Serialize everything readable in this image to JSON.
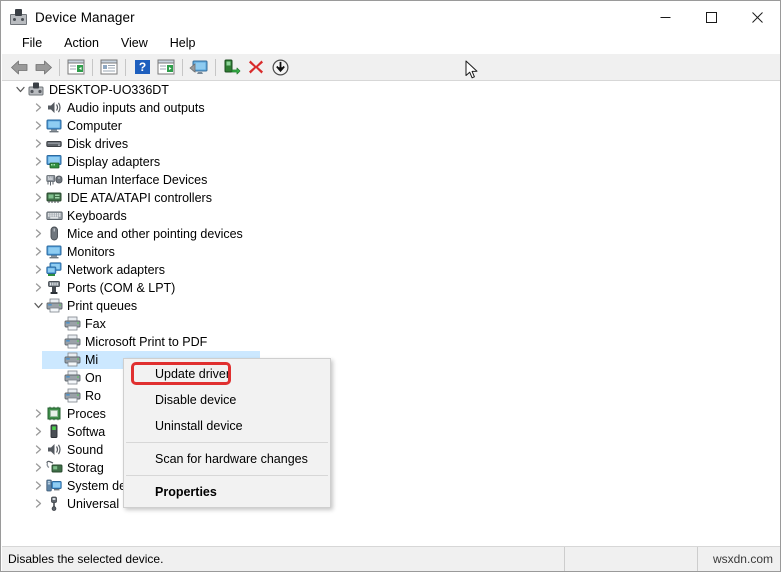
{
  "window": {
    "title": "Device Manager",
    "icon": "device-manager-icon",
    "minimize_label": "Minimize",
    "maximize_label": "Maximize",
    "close_label": "Close"
  },
  "menubar": {
    "items": [
      {
        "label": "File",
        "name": "menu-file"
      },
      {
        "label": "Action",
        "name": "menu-action"
      },
      {
        "label": "View",
        "name": "menu-view"
      },
      {
        "label": "Help",
        "name": "menu-help"
      }
    ]
  },
  "toolbar": {
    "buttons": [
      {
        "name": "back-button",
        "icon": "arrow-left-icon",
        "tooltip": "Back"
      },
      {
        "name": "forward-button",
        "icon": "arrow-right-icon",
        "tooltip": "Forward"
      },
      {
        "name": "show-hide-console-tree-button",
        "icon": "console-tree-icon",
        "tooltip": "Show/Hide Console Tree"
      },
      {
        "name": "properties-button",
        "icon": "properties-icon",
        "tooltip": "Properties"
      },
      {
        "name": "help-button",
        "icon": "help-icon",
        "tooltip": "Help"
      },
      {
        "name": "action-menu-button",
        "icon": "action-menu-icon",
        "tooltip": "Action"
      },
      {
        "name": "scan-hardware-changes-button",
        "icon": "scan-monitor-icon",
        "tooltip": "Scan for hardware changes"
      },
      {
        "name": "update-driver-button",
        "icon": "update-driver-icon",
        "tooltip": "Update Driver Software"
      },
      {
        "name": "uninstall-device-button",
        "icon": "red-x-icon",
        "tooltip": "Uninstall device"
      },
      {
        "name": "disable-device-button",
        "icon": "disable-arrow-icon",
        "tooltip": "Disable device"
      }
    ]
  },
  "tree": {
    "root": {
      "label": "DESKTOP-UO336DT",
      "icon": "computer-root-icon",
      "expanded": true,
      "indent": 0
    },
    "items": [
      {
        "label": "Audio inputs and outputs",
        "icon": "speaker-icon",
        "expanded": false,
        "indent": 1
      },
      {
        "label": "Computer",
        "icon": "monitor-icon",
        "expanded": false,
        "indent": 1
      },
      {
        "label": "Disk drives",
        "icon": "disk-drive-icon",
        "expanded": false,
        "indent": 1
      },
      {
        "label": "Display adapters",
        "icon": "display-adapter-icon",
        "expanded": false,
        "indent": 1
      },
      {
        "label": "Human Interface Devices",
        "icon": "hid-icon",
        "expanded": false,
        "indent": 1
      },
      {
        "label": "IDE ATA/ATAPI controllers",
        "icon": "ide-controller-icon",
        "expanded": false,
        "indent": 1
      },
      {
        "label": "Keyboards",
        "icon": "keyboard-icon",
        "expanded": false,
        "indent": 1
      },
      {
        "label": "Mice and other pointing devices",
        "icon": "mouse-icon",
        "expanded": false,
        "indent": 1
      },
      {
        "label": "Monitors",
        "icon": "monitor-icon",
        "expanded": false,
        "indent": 1
      },
      {
        "label": "Network adapters",
        "icon": "network-adapter-icon",
        "expanded": false,
        "indent": 1
      },
      {
        "label": "Ports (COM & LPT)",
        "icon": "port-icon",
        "expanded": false,
        "indent": 1
      },
      {
        "label": "Print queues",
        "icon": "printer-icon",
        "expanded": true,
        "indent": 1
      },
      {
        "label": "Fax",
        "icon": "printer-icon",
        "expanded": null,
        "indent": 2
      },
      {
        "label": "Microsoft Print to PDF",
        "icon": "printer-icon",
        "expanded": null,
        "indent": 2
      },
      {
        "label": "Microsoft XPS Document Writer",
        "icon": "printer-icon",
        "expanded": null,
        "indent": 2,
        "selected": true,
        "truncated": "Mi"
      },
      {
        "label": "OneNote",
        "icon": "printer-icon",
        "expanded": null,
        "indent": 2,
        "truncated": "On"
      },
      {
        "label": "Root Print Queue",
        "icon": "printer-icon",
        "expanded": null,
        "indent": 2,
        "truncated": "Ro"
      },
      {
        "label": "Processors",
        "icon": "processor-icon",
        "expanded": false,
        "indent": 1,
        "truncated": "Proces"
      },
      {
        "label": "Software devices",
        "icon": "software-device-icon",
        "expanded": false,
        "indent": 1,
        "truncated": "Softwa"
      },
      {
        "label": "Sound, video and game controllers",
        "icon": "speaker-icon",
        "expanded": false,
        "indent": 1,
        "truncated": "Sound"
      },
      {
        "label": "Storage controllers",
        "icon": "storage-controller-icon",
        "expanded": false,
        "indent": 1,
        "truncated": "Storag"
      },
      {
        "label": "System devices",
        "icon": "system-device-icon",
        "expanded": false,
        "indent": 1
      },
      {
        "label": "Universal Serial Bus controllers",
        "icon": "usb-icon",
        "expanded": false,
        "indent": 1
      }
    ]
  },
  "context_menu": {
    "highlighted_item": "Update driver",
    "highlight_color": "#e03030",
    "items": [
      {
        "label": "Update driver",
        "name": "ctx-update-driver",
        "bold": false,
        "separator_after": false
      },
      {
        "label": "Disable device",
        "name": "ctx-disable-device",
        "bold": false,
        "separator_after": false
      },
      {
        "label": "Uninstall device",
        "name": "ctx-uninstall-device",
        "bold": false,
        "separator_after": true
      },
      {
        "label": "Scan for hardware changes",
        "name": "ctx-scan-hardware-changes",
        "bold": false,
        "separator_after": true
      },
      {
        "label": "Properties",
        "name": "ctx-properties",
        "bold": true,
        "separator_after": false
      }
    ]
  },
  "statusbar": {
    "message": "Disables the selected device.",
    "middle": "",
    "watermark": "wsxdn.com"
  },
  "colors": {
    "selection": "#cce8ff",
    "toolbar_bg": "#f0f0f0",
    "menu_bg": "#f2f2f2",
    "accent_red": "#e03030"
  }
}
